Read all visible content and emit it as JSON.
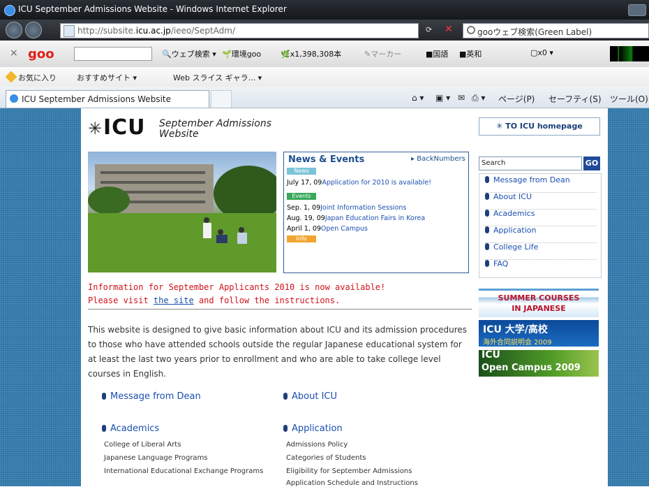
{
  "window": {
    "title": "ICU September Admissions Website - Windows Internet Explorer"
  },
  "address_bar": {
    "url_prefix": "http://subsite.",
    "url_domain": "icu.ac.jp",
    "url_path": "/ieeo/SeptAdm/",
    "search_placeholder": "gooウェブ検索(Green Label)"
  },
  "goo_toolbar": {
    "logo": "goo",
    "web_search": "ウェブ検索",
    "eco": "環境goo",
    "counter": "x1,398,308本",
    "marker": "マーカー",
    "kokugo": "国語",
    "eiwa": "英和",
    "x0": "x0"
  },
  "favorites_bar": {
    "favorites": "お気に入り",
    "recommended": "おすすめサイト",
    "webslice": "Web スライス ギャラ..."
  },
  "tabs": [
    {
      "label": "ICU September Admissions Website"
    }
  ],
  "command_bar": {
    "page": "ページ(P)",
    "safety": "セーフティ(S)",
    "tools": "ツール(O)"
  },
  "site": {
    "logo_mark": "✳",
    "logo_text": "ICU",
    "logo_sub1": "September Admissions",
    "logo_sub2": "Website",
    "to_home": "✳ TO ICU homepage",
    "news": {
      "title": "News & Events",
      "backnumbers": "BackNumbers",
      "tag_news": "News",
      "tag_events": "Events",
      "tag_info": "Info",
      "items": [
        {
          "date": "July 17, 09",
          "text": "Application for 2010 is available!"
        },
        {
          "date": "Sep. 1, 09",
          "text": "Joint Information Sessions"
        },
        {
          "date": "Aug. 19, 09",
          "text": "Japan Education Fairs in Korea"
        },
        {
          "date": "April 1, 09",
          "text": "Open Campus"
        }
      ]
    },
    "search": {
      "placeholder": "Search",
      "go": "GO"
    },
    "sidenav": [
      "Message from Dean",
      "About ICU",
      "Academics",
      "Application",
      "College Life",
      "FAQ"
    ],
    "banners": {
      "summer1": "SUMMER COURSES",
      "summer2": "IN JAPANESE",
      "fair1": "ICU 大学/高校",
      "fair2": "海外合同説明会 2009",
      "open1": "ICU",
      "open2": "Open Campus 2009"
    },
    "info_line1": "Information for September Applicants 2010 is now available!",
    "info_line2_pre": "Please visit ",
    "info_line2_link": "the site",
    "info_line2_post": " and follow the instructions.",
    "intro": "This website is designed to give basic information about ICU and its admission procedures to those who have attended schools outside the regular Japanese educational system for at least the last two years prior to enrollment and who are able to take college level courses in English.",
    "links": {
      "message": "Message from Dean",
      "about": "About ICU",
      "academics": "Academics",
      "application": "Application",
      "academics_sub": [
        "College of Liberal Arts",
        "Japanese Language Programs",
        "International Educational Exchange Programs"
      ],
      "application_sub": [
        "Admissions Policy",
        "Categories of Students",
        "Eligibility for September Admissions",
        "Application Schedule and Instructions"
      ]
    }
  },
  "colors": {
    "accent": "#1e4f91",
    "alert": "#d0121b",
    "page_bg": "#2f76a8"
  }
}
